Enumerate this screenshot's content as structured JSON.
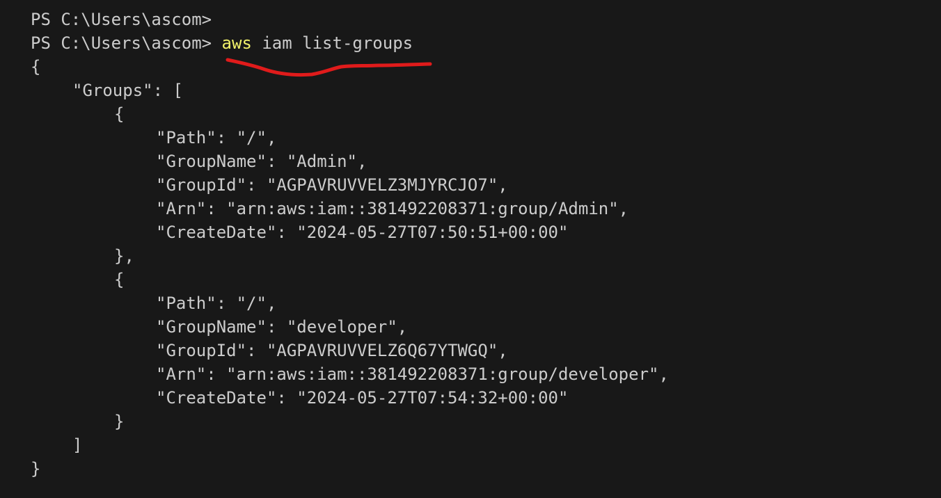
{
  "terminal": {
    "prompt_1": "PS C:\\Users\\ascom>",
    "prompt_2": "PS C:\\Users\\ascom>",
    "command_name": "aws",
    "command_args": "iam list-groups",
    "highlight_color": "#f1f16a",
    "annotation_color": "#e01b1b"
  },
  "output": {
    "lines": [
      {
        "indent": 0,
        "text": "{"
      },
      {
        "indent": 1,
        "text": "\"Groups\": ["
      },
      {
        "indent": 2,
        "text": "{"
      },
      {
        "indent": 3,
        "text": "\"Path\": \"/\","
      },
      {
        "indent": 3,
        "text": "\"GroupName\": \"Admin\","
      },
      {
        "indent": 3,
        "text": "\"GroupId\": \"AGPAVRUVVELZ3MJYRCJO7\","
      },
      {
        "indent": 3,
        "text": "\"Arn\": \"arn:aws:iam::381492208371:group/Admin\","
      },
      {
        "indent": 3,
        "text": "\"CreateDate\": \"2024-05-27T07:50:51+00:00\""
      },
      {
        "indent": 2,
        "text": "},"
      },
      {
        "indent": 2,
        "text": "{"
      },
      {
        "indent": 3,
        "text": "\"Path\": \"/\","
      },
      {
        "indent": 3,
        "text": "\"GroupName\": \"developer\","
      },
      {
        "indent": 3,
        "text": "\"GroupId\": \"AGPAVRUVVELZ6Q67YTWGQ\","
      },
      {
        "indent": 3,
        "text": "\"Arn\": \"arn:aws:iam::381492208371:group/developer\","
      },
      {
        "indent": 3,
        "text": "\"CreateDate\": \"2024-05-27T07:54:32+00:00\""
      },
      {
        "indent": 2,
        "text": "}"
      },
      {
        "indent": 1,
        "text": "]"
      },
      {
        "indent": 0,
        "text": "}"
      }
    ]
  }
}
